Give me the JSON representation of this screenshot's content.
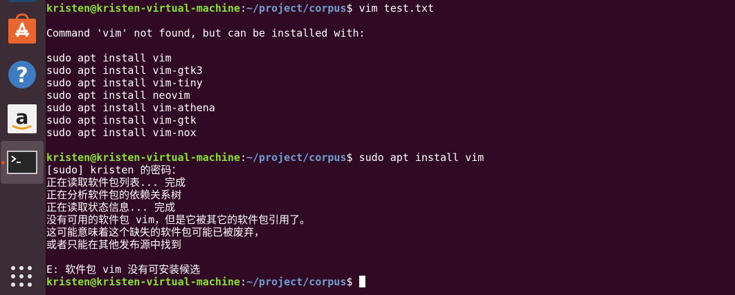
{
  "dock": {
    "items": [
      {
        "name": "ubuntu-software",
        "icon": "shopping-bag-icon"
      },
      {
        "name": "help",
        "icon": "help-icon"
      },
      {
        "name": "amazon",
        "icon": "amazon-icon"
      },
      {
        "name": "terminal",
        "icon": "terminal-icon",
        "active": true
      }
    ],
    "apps_icon": "app-grid-icon"
  },
  "terminal": {
    "colors": {
      "background": "#300a24",
      "user": "#8ae234",
      "path": "#729fcf",
      "text": "#ffffff"
    },
    "prompt_user": "kristen@kristen-virtual-machine",
    "prompt_path": "~/project/corpus",
    "lines": [
      {
        "type": "prompt",
        "cmd": "vim test.txt"
      },
      {
        "type": "text",
        "text": ""
      },
      {
        "type": "text",
        "text": "Command 'vim' not found, but can be installed with:"
      },
      {
        "type": "text",
        "text": ""
      },
      {
        "type": "text",
        "text": "sudo apt install vim"
      },
      {
        "type": "text",
        "text": "sudo apt install vim-gtk3"
      },
      {
        "type": "text",
        "text": "sudo apt install vim-tiny"
      },
      {
        "type": "text",
        "text": "sudo apt install neovim"
      },
      {
        "type": "text",
        "text": "sudo apt install vim-athena"
      },
      {
        "type": "text",
        "text": "sudo apt install vim-gtk"
      },
      {
        "type": "text",
        "text": "sudo apt install vim-nox"
      },
      {
        "type": "text",
        "text": ""
      },
      {
        "type": "prompt",
        "cmd": "sudo apt install vim"
      },
      {
        "type": "text",
        "text": "[sudo] kristen 的密码："
      },
      {
        "type": "text",
        "text": "正在读取软件包列表... 完成"
      },
      {
        "type": "text",
        "text": "正在分析软件包的依赖关系树"
      },
      {
        "type": "text",
        "text": "正在读取状态信息... 完成"
      },
      {
        "type": "text",
        "text": "没有可用的软件包 vim，但是它被其它的软件包引用了。"
      },
      {
        "type": "text",
        "text": "这可能意味着这个缺失的软件包可能已被废弃，"
      },
      {
        "type": "text",
        "text": "或者只能在其他发布源中找到"
      },
      {
        "type": "text",
        "text": ""
      },
      {
        "type": "text",
        "text": "E: 软件包 vim 没有可安装候选"
      },
      {
        "type": "prompt",
        "cmd": "",
        "cursor": true
      }
    ]
  }
}
